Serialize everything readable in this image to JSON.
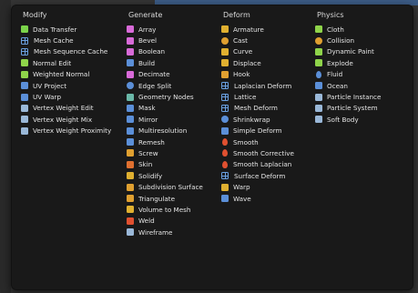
{
  "columns": [
    {
      "key": "modify",
      "title": "Modify",
      "items": [
        {
          "label": "Data Transfer",
          "icon": "data-transfer-icon",
          "color": "#7bd34a"
        },
        {
          "label": "Mesh Cache",
          "icon": "mesh-cache-icon",
          "color": "#6aa0e0",
          "shape": "grid"
        },
        {
          "label": "Mesh Sequence Cache",
          "icon": "mesh-sequence-cache-icon",
          "color": "#6aa0e0",
          "shape": "grid"
        },
        {
          "label": "Normal Edit",
          "icon": "normal-edit-icon",
          "color": "#8fd44a"
        },
        {
          "label": "Weighted Normal",
          "icon": "weighted-normal-icon",
          "color": "#8fd44a"
        },
        {
          "label": "UV Project",
          "icon": "uv-project-icon",
          "color": "#5b8fd8"
        },
        {
          "label": "UV Warp",
          "icon": "uv-warp-icon",
          "color": "#5b8fd8"
        },
        {
          "label": "Vertex Weight Edit",
          "icon": "vertex-weight-edit-icon",
          "color": "#9ab8d8"
        },
        {
          "label": "Vertex Weight Mix",
          "icon": "vertex-weight-mix-icon",
          "color": "#9ab8d8"
        },
        {
          "label": "Vertex Weight Proximity",
          "icon": "vertex-weight-proximity-icon",
          "color": "#9ab8d8"
        }
      ]
    },
    {
      "key": "generate",
      "title": "Generate",
      "items": [
        {
          "label": "Array",
          "icon": "array-icon",
          "color": "#d86ad8"
        },
        {
          "label": "Bevel",
          "icon": "bevel-icon",
          "color": "#d86ad8"
        },
        {
          "label": "Boolean",
          "icon": "boolean-icon",
          "color": "#d86ad8"
        },
        {
          "label": "Build",
          "icon": "build-icon",
          "color": "#5b8fd8"
        },
        {
          "label": "Decimate",
          "icon": "decimate-icon",
          "color": "#d86ad8"
        },
        {
          "label": "Edge Split",
          "icon": "edge-split-icon",
          "color": "#5b8fd8",
          "shape": "round"
        },
        {
          "label": "Geometry Nodes",
          "icon": "geometry-nodes-icon",
          "color": "#6ab8a8"
        },
        {
          "label": "Mask",
          "icon": "mask-icon",
          "color": "#5b8fd8"
        },
        {
          "label": "Mirror",
          "icon": "mirror-icon",
          "color": "#5b8fd8"
        },
        {
          "label": "Multiresolution",
          "icon": "multiresolution-icon",
          "color": "#5b8fd8"
        },
        {
          "label": "Remesh",
          "icon": "remesh-icon",
          "color": "#5b8fd8"
        },
        {
          "label": "Screw",
          "icon": "screw-icon",
          "color": "#e0a030"
        },
        {
          "label": "Skin",
          "icon": "skin-icon",
          "color": "#e07030"
        },
        {
          "label": "Solidify",
          "icon": "solidify-icon",
          "color": "#e0b030"
        },
        {
          "label": "Subdivision Surface",
          "icon": "subdivision-surface-icon",
          "color": "#e0a030"
        },
        {
          "label": "Triangulate",
          "icon": "triangulate-icon",
          "color": "#e0a030"
        },
        {
          "label": "Volume to Mesh",
          "icon": "volume-to-mesh-icon",
          "color": "#e0b030"
        },
        {
          "label": "Weld",
          "icon": "weld-icon",
          "color": "#e05030"
        },
        {
          "label": "Wireframe",
          "icon": "wireframe-icon",
          "color": "#9ab8d8"
        }
      ]
    },
    {
      "key": "deform",
      "title": "Deform",
      "items": [
        {
          "label": "Armature",
          "icon": "armature-icon",
          "color": "#e0b030"
        },
        {
          "label": "Cast",
          "icon": "cast-icon",
          "color": "#e0a030",
          "shape": "round"
        },
        {
          "label": "Curve",
          "icon": "curve-icon",
          "color": "#e0b030"
        },
        {
          "label": "Displace",
          "icon": "displace-icon",
          "color": "#e0b030"
        },
        {
          "label": "Hook",
          "icon": "hook-icon",
          "color": "#e0a030"
        },
        {
          "label": "Laplacian Deform",
          "icon": "laplacian-deform-icon",
          "color": "#6aa0e0",
          "shape": "grid"
        },
        {
          "label": "Lattice",
          "icon": "lattice-icon",
          "color": "#6aa0e0",
          "shape": "grid"
        },
        {
          "label": "Mesh Deform",
          "icon": "mesh-deform-icon",
          "color": "#6aa0e0",
          "shape": "grid"
        },
        {
          "label": "Shrinkwrap",
          "icon": "shrinkwrap-icon",
          "color": "#5b8fd8",
          "shape": "round"
        },
        {
          "label": "Simple Deform",
          "icon": "simple-deform-icon",
          "color": "#5b8fd8"
        },
        {
          "label": "Smooth",
          "icon": "smooth-icon",
          "color": "#e05030",
          "shape": "drop"
        },
        {
          "label": "Smooth Corrective",
          "icon": "smooth-corrective-icon",
          "color": "#e05030",
          "shape": "drop"
        },
        {
          "label": "Smooth Laplacian",
          "icon": "smooth-laplacian-icon",
          "color": "#e05030",
          "shape": "drop"
        },
        {
          "label": "Surface Deform",
          "icon": "surface-deform-icon",
          "color": "#6aa0e0",
          "shape": "grid"
        },
        {
          "label": "Warp",
          "icon": "warp-icon",
          "color": "#e0b030"
        },
        {
          "label": "Wave",
          "icon": "wave-icon",
          "color": "#5b8fd8"
        }
      ]
    },
    {
      "key": "physics",
      "title": "Physics",
      "items": [
        {
          "label": "Cloth",
          "icon": "cloth-icon",
          "color": "#8fd44a"
        },
        {
          "label": "Collision",
          "icon": "collision-icon",
          "color": "#e0a030",
          "shape": "round"
        },
        {
          "label": "Dynamic Paint",
          "icon": "dynamic-paint-icon",
          "color": "#8fd44a"
        },
        {
          "label": "Explode",
          "icon": "explode-icon",
          "color": "#8fd44a"
        },
        {
          "label": "Fluid",
          "icon": "fluid-icon",
          "color": "#5b8fd8",
          "shape": "drop"
        },
        {
          "label": "Ocean",
          "icon": "ocean-icon",
          "color": "#5b8fd8"
        },
        {
          "label": "Particle Instance",
          "icon": "particle-instance-icon",
          "color": "#9ab8d8"
        },
        {
          "label": "Particle System",
          "icon": "particle-system-icon",
          "color": "#9ab8d8"
        },
        {
          "label": "Soft Body",
          "icon": "soft-body-icon",
          "color": "#9ab8d8"
        }
      ]
    }
  ]
}
